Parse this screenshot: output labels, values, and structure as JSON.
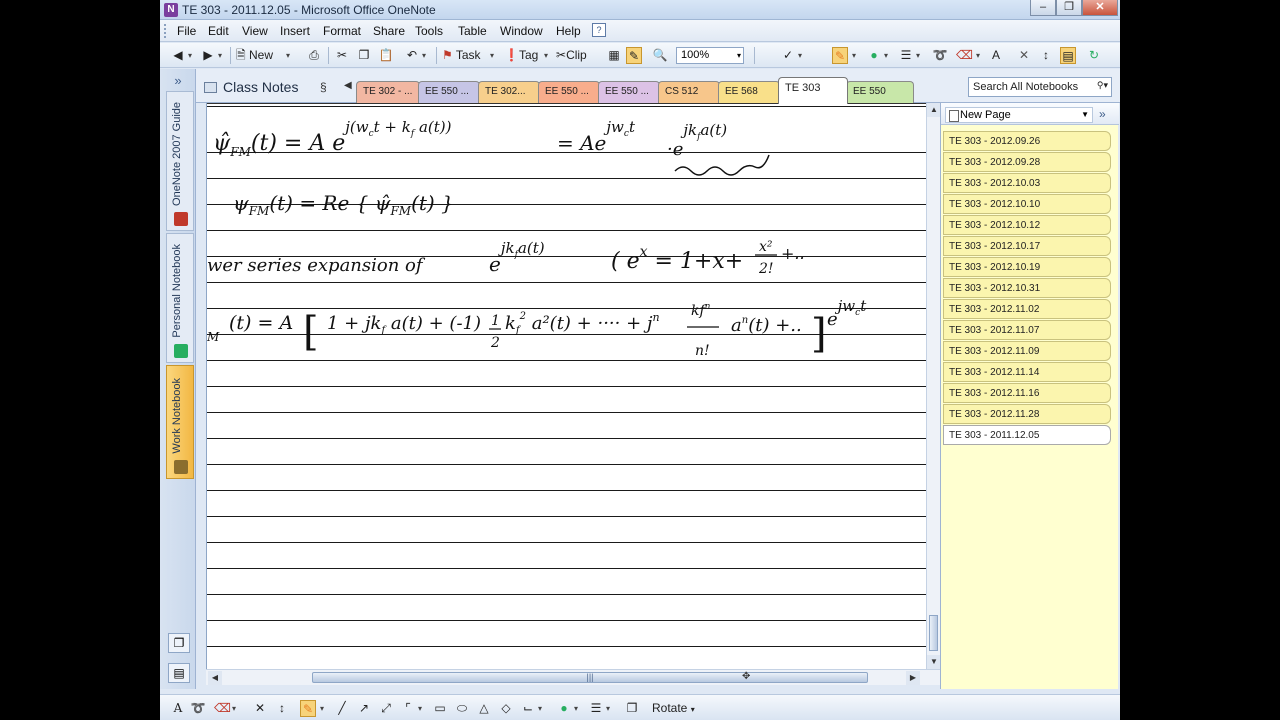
{
  "window": {
    "title": "TE 303 - 2011.12.05 - Microsoft Office OneNote",
    "app_icon": "N",
    "buttons": [
      "minimize",
      "maximize",
      "close"
    ]
  },
  "menubar": {
    "items": [
      "File",
      "Edit",
      "View",
      "Insert",
      "Format",
      "Share",
      "Tools",
      "Table",
      "Window",
      "Help"
    ]
  },
  "toolbar": {
    "new_label": "New",
    "task_label": "Task",
    "tag_label": "Tag",
    "clip_label": "Clip",
    "zoom": "100%",
    "icons": [
      "back-icon",
      "forward-icon",
      "new-page-icon",
      "print-icon",
      "cut-icon",
      "copy-icon",
      "paste-icon",
      "undo-icon",
      "task-flag-icon",
      "tag-icon",
      "clip-icon",
      "table-icon",
      "pen-mode-icon",
      "zoom-icon",
      "spelling-icon",
      "pen-icon",
      "color-icon",
      "line-weight-icon",
      "eraser-icon",
      "text-mode-icon",
      "delete-icon",
      "insert-space-icon",
      "page-icon",
      "sync-icon"
    ]
  },
  "nav": {
    "notebooks": [
      {
        "label": "OneNote 2007 Guide",
        "active": false
      },
      {
        "label": "Personal Notebook",
        "active": false
      },
      {
        "label": "Work Notebook",
        "active": true
      }
    ]
  },
  "sections": {
    "notebook_name": "Class Notes",
    "tabs": [
      {
        "label": "TE 302 - ...",
        "color": "#f2b7a2"
      },
      {
        "label": "EE 550 ...",
        "color": "#c6c5e6"
      },
      {
        "label": "TE 302...",
        "color": "#f7cf8c"
      },
      {
        "label": "EE 550 ...",
        "color": "#f8ad8c"
      },
      {
        "label": "EE 550 ...",
        "color": "#dcc2e6"
      },
      {
        "label": "CS 512",
        "color": "#f7c68b"
      },
      {
        "label": "EE 568",
        "color": "#f9e08a"
      },
      {
        "label": "TE 303",
        "color": "#ffffff",
        "active": true
      },
      {
        "label": "EE 550",
        "color": "#c8e7a9"
      }
    ],
    "search_placeholder": "Search All Notebooks"
  },
  "pages": {
    "new_page_label": "New Page",
    "items": [
      "TE 303 - 2012.09.26",
      "TE 303 - 2012.09.28",
      "TE 303 - 2012.10.03",
      "TE 303 - 2012.10.10",
      "TE 303 - 2012.10.12",
      "TE 303 - 2012.10.17",
      "TE 303 - 2012.10.19",
      "TE 303 - 2012.10.31",
      "TE 303 - 2012.11.02",
      "TE 303 - 2012.11.07",
      "TE 303 - 2012.11.09",
      "TE 303 - 2012.11.14",
      "TE 303 - 2012.11.16",
      "TE 303 - 2012.11.28",
      "TE 303 - 2011.12.05"
    ],
    "active_index": 14
  },
  "note": {
    "lines": [
      "ψ̂FM(t) = A e^{j(wc t + kf a(t))} = A e^{jwc t} · e^{jkf a(t)}",
      "ψFM(t) = Re{ ψ̂FM(t) }",
      "wer series expansion of  e^{jkf a(t)}   ( e^x = 1 + x + x²/2! + ..",
      "M(t) = A [ 1 + jkf a(t) + (-1) 1/2 kf² a²(t) + ... + jⁿ kfⁿ/n! aⁿ(t) + .. ] e^{jwc t}"
    ]
  },
  "drawbar": {
    "rotate_label": "Rotate",
    "icons": [
      "text-mode-icon",
      "lasso-icon",
      "eraser-icon",
      "delete-icon",
      "insert-space-icon",
      "pen-icon",
      "line-icon",
      "arrow-icon",
      "double-arrow-icon",
      "axis-icon",
      "rectangle-icon",
      "oval-icon",
      "triangle-icon",
      "diamond-icon",
      "graph-icon",
      "color-icon",
      "line-weight-icon",
      "arrange-icon"
    ]
  }
}
